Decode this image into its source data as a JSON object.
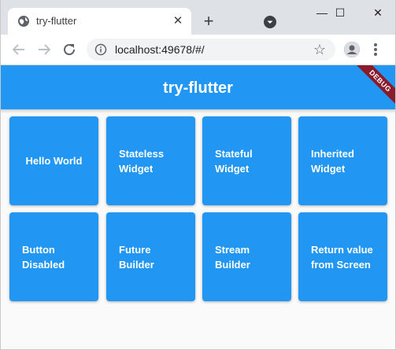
{
  "browser": {
    "tab_title": "try-flutter",
    "tab_close": "✕",
    "new_tab": "+",
    "url": "localhost:49678/#/",
    "star": "☆",
    "window_controls": {
      "minimize": "—",
      "maximize": "☐",
      "close": "✕"
    }
  },
  "app": {
    "title": "try-flutter",
    "debug_banner": "DEBUG",
    "primary_color": "#2196f3",
    "cards": [
      {
        "label": "Hello World"
      },
      {
        "label": "Stateless\nWidget"
      },
      {
        "label": "Stateful\nWidget"
      },
      {
        "label": "Inherited\nWidget"
      },
      {
        "label": "Button\nDisabled"
      },
      {
        "label": "Future\nBuilder"
      },
      {
        "label": "Stream\nBuilder"
      },
      {
        "label": "Return value\nfrom Screen"
      }
    ]
  },
  "icons": {
    "favicon": "globe-icon",
    "tab_search": "tab-search-icon",
    "back": "arrow-left-icon",
    "forward": "arrow-right-icon",
    "reload": "reload-icon",
    "site_info": "info-icon",
    "bookmark": "star-icon",
    "profile": "profile-icon",
    "menu": "more-vert-icon"
  }
}
